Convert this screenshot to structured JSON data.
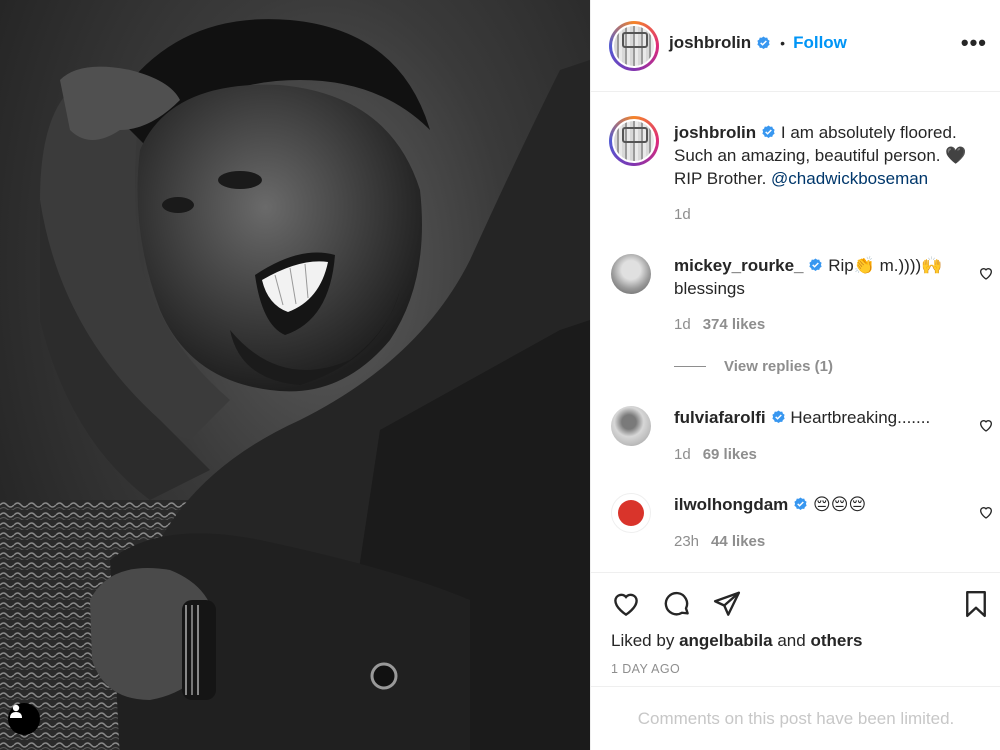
{
  "post": {
    "author": "joshbrolin",
    "follow_label": "Follow",
    "separator": "•",
    "more_label": "•••",
    "caption_text": "I am absolutely floored. Such an amazing, beautiful person. 🖤 RIP Brother.",
    "caption_mention": "@chadwickboseman",
    "caption_time": "1d"
  },
  "comments": [
    {
      "username": "mickey_rourke_",
      "text": "Rip👏 m.))))🙌 blessings",
      "time": "1d",
      "likes": "374 likes"
    },
    {
      "username": "fulviafarolfi",
      "text": "Heartbreaking.......",
      "time": "1d",
      "likes": "69 likes"
    },
    {
      "username": "ilwolhongdam",
      "text": "😔😔😔",
      "time": "23h",
      "likes": "44 likes"
    }
  ],
  "view_replies": "View replies (1)",
  "footer": {
    "liked_prefix": "Liked by",
    "liked_user": "angelbabila",
    "liked_and": "and",
    "liked_others": "others",
    "time_ago": "1 DAY AGO",
    "limited_notice": "Comments on this post have been limited."
  },
  "icons": {
    "like": "heart-icon",
    "comment": "comment-icon",
    "share": "share-icon",
    "save": "bookmark-icon",
    "verified": "verified-badge-icon",
    "tag": "user-tag-icon"
  },
  "colors": {
    "link": "#0095f6",
    "mention": "#00376b",
    "muted": "#8e8e8e",
    "verified": "#3897f0"
  }
}
